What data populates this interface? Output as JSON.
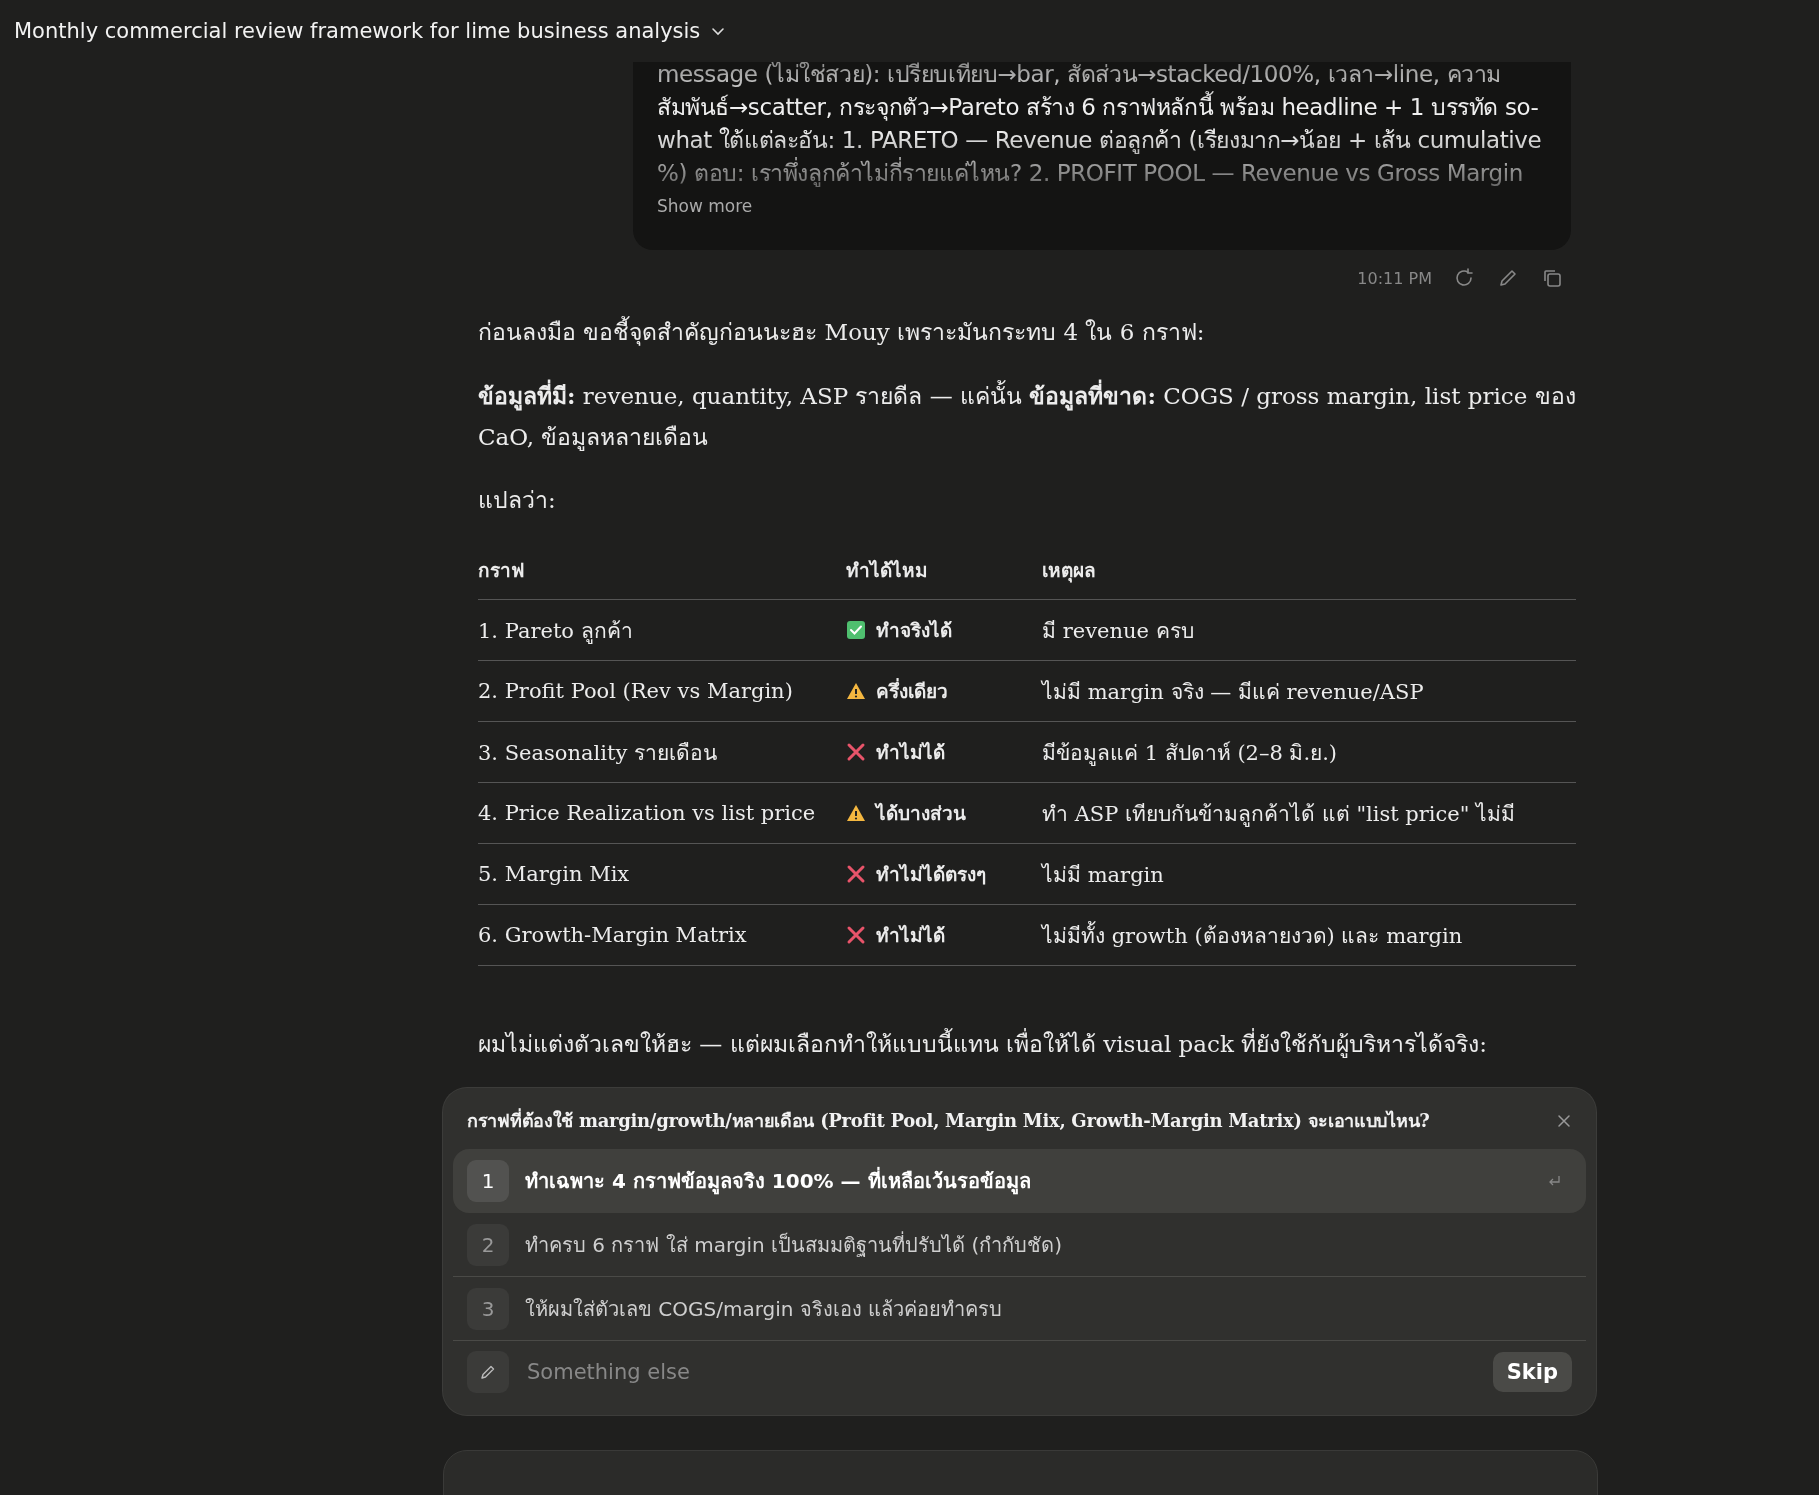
{
  "header": {
    "title": "Monthly commercial review framework for lime business analysis"
  },
  "user_message": {
    "lines": [
      "message (ไม่ใช่สวย): เปรียบเทียบ→bar, สัดส่วน→stacked/100%, เวลา→line, ความ",
      "สัมพันธ์→scatter, กระจุกตัว→Pareto สร้าง 6 กราฟหลักนี้ พร้อม headline + 1 บรรทัด so-",
      "what ใต้แต่ละอัน: 1. PARETO — Revenue ต่อลูกค้า (เรียงมาก→น้อย + เส้น cumulative",
      "%) ตอบ: เราพึ่งลูกค้าไม่กี่รายแค่ไหน? 2. PROFIT POOL — Revenue vs Gross Margin"
    ],
    "show_more": "Show more",
    "time": "10:11 PM"
  },
  "reply": {
    "paragraphs": [
      "ก่อนลงมือ ขอชี้จุดสำคัญก่อนนะฮะ Mouy เพราะมันกระทบ 4 ใน 6 กราฟ:",
      "**ข้อมูลที่มี:** revenue, quantity, ASP รายดีล — แค่นั้น **ข้อมูลที่ขาด:** COGS / gross margin, list price ของ CaO, ข้อมูลหลายเดือน",
      "แปลว่า:"
    ],
    "table": {
      "columns": [
        "กราฟ",
        "ทำได้ไหม",
        "เหตุผล"
      ],
      "rows": [
        {
          "chart": "1. Pareto ลูกค้า",
          "kind": "ok",
          "status": "ทำจริงได้",
          "reason": "มี revenue ครบ"
        },
        {
          "chart": "2. Profit Pool (Rev vs Margin)",
          "kind": "partial",
          "status": "ครึ่งเดียว",
          "reason": "ไม่มี margin จริง — มีแค่ revenue/ASP"
        },
        {
          "chart": "3. Seasonality รายเดือน",
          "kind": "no",
          "status": "ทำไม่ได้",
          "reason": "มีข้อมูลแค่ 1 สัปดาห์ (2–8 มิ.ย.)"
        },
        {
          "chart": "4. Price Realization vs list price",
          "kind": "partial",
          "status": "ได้บางส่วน",
          "reason": "ทำ ASP เทียบกันข้ามลูกค้าได้ แต่ \"list price\" ไม่มี"
        },
        {
          "chart": "5. Margin Mix",
          "kind": "no",
          "status": "ทำไม่ได้ตรงๆ",
          "reason": "ไม่มี margin"
        },
        {
          "chart": "6. Growth-Margin Matrix",
          "kind": "no",
          "status": "ทำไม่ได้",
          "reason": "ไม่มีทั้ง growth (ต้องหลายงวด) และ margin"
        }
      ]
    },
    "after": [
      "ผมไม่แต่งตัวเลขให้ฮะ — แต่ผมเลือกทำให้แบบนี้แทน เพื่อให้ได้ visual pack ที่ยังใช้กับผู้บริหารได้จริง:"
    ]
  },
  "question": {
    "title": "กราฟที่ต้องใช้ margin/growth/หลายเดือน (Profit Pool, Margin Mix, Growth-Margin Matrix) จะเอาแบบไหน?",
    "options": [
      {
        "number": "1",
        "label": "ทำเฉพาะ 4 กราฟข้อมูลจริง 100% — ที่เหลือเว้นรอข้อมูล",
        "selected": true
      },
      {
        "number": "2",
        "label": "ทำครบ 6 กราฟ ใส่ margin เป็นสมมติฐานที่ปรับได้ (กำกับชัด)",
        "selected": false
      },
      {
        "number": "3",
        "label": "ให้ผมใส่ตัวเลข COGS/margin จริงเอง แล้วค่อยทำครบ",
        "selected": false
      }
    ],
    "other_placeholder": "Something else",
    "skip": "Skip"
  }
}
